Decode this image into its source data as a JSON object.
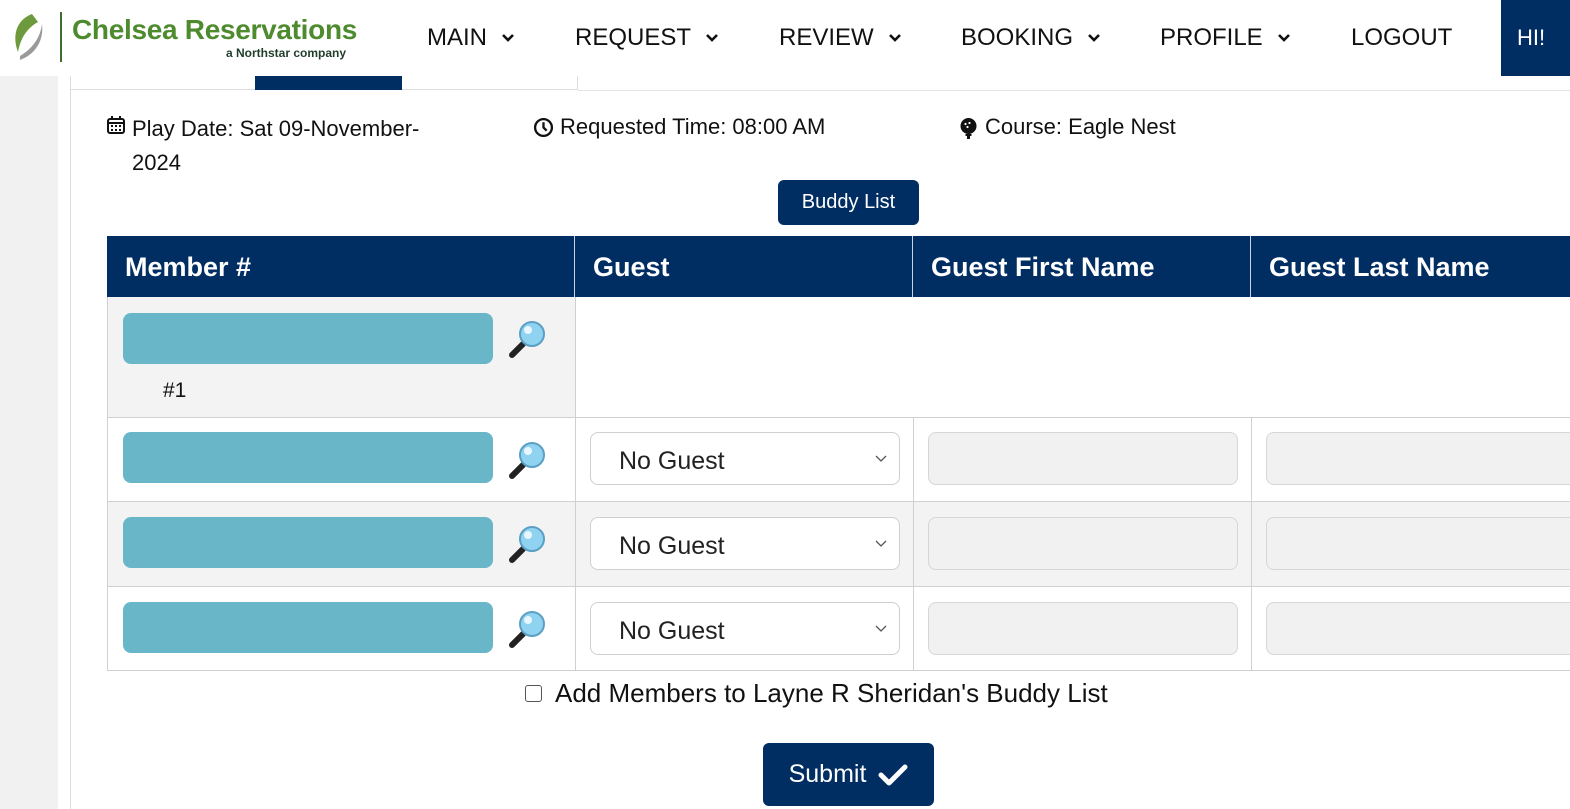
{
  "brand": {
    "name": "Chelsea Reservations",
    "tagline": "a Northstar company"
  },
  "nav": {
    "items": [
      {
        "label": "MAIN"
      },
      {
        "label": "REQUEST"
      },
      {
        "label": "REVIEW"
      },
      {
        "label": "BOOKING"
      },
      {
        "label": "PROFILE"
      },
      {
        "label": "LOGOUT"
      }
    ],
    "greeting": "HI!"
  },
  "info": {
    "play_date": "Play Date: Sat 09-November-2024",
    "requested_time": "Requested Time: 08:00 AM",
    "course": "Course: Eagle Nest"
  },
  "buttons": {
    "buddy_list": "Buddy List",
    "submit": "Submit"
  },
  "table": {
    "headers": [
      "Member #",
      "Guest",
      "Guest First Name",
      "Guest Last Name"
    ],
    "first_row_label": "#1",
    "guest_default": "No Guest"
  },
  "buddy_checkbox_label": "Add Members to Layne R Sheridan's Buddy List",
  "colors": {
    "primary": "#002d62",
    "member_input": "#6ab6c9",
    "brand_green": "#4e8a2e"
  },
  "icons": [
    "logo-mark-icon",
    "chevron-down-icon",
    "calendar-icon",
    "clock-icon",
    "golf-ball-icon",
    "magnifier-icon",
    "checkmark-icon"
  ]
}
